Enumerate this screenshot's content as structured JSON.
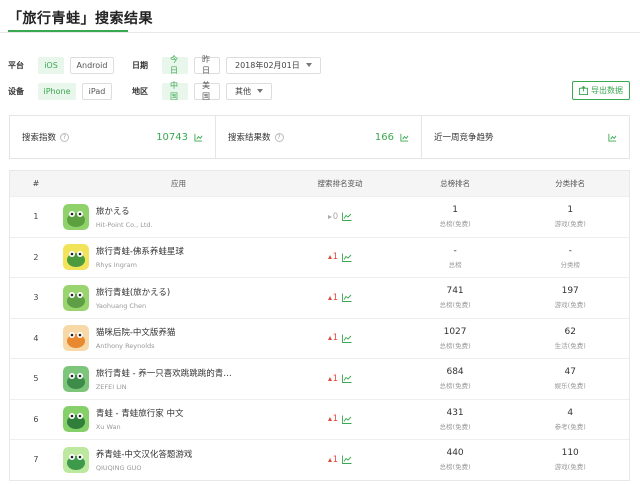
{
  "page": {
    "title": "「旅行青蛙」搜索结果"
  },
  "filters": {
    "platform_label": "平台",
    "platform_options": [
      "iOS",
      "Android"
    ],
    "date_label": "日期",
    "date_today": "今日",
    "date_yesterday": "昨日",
    "date_value": "2018年02月01日",
    "device_label": "设备",
    "device_options": [
      "iPhone",
      "iPad"
    ],
    "region_label": "地区",
    "region_options": [
      "中国",
      "美国"
    ],
    "region_other": "其他"
  },
  "export_label": "导出数据",
  "stats": {
    "search_index_label": "搜索指数",
    "search_index_value": "10743",
    "result_count_label": "搜索结果数",
    "result_count_value": "166",
    "trend_label": "近一周竞争趋势"
  },
  "table": {
    "headers": {
      "idx": "#",
      "app": "应用",
      "variation": "搜索排名变动",
      "total_rank": "总榜排名",
      "category_rank": "分类排名"
    },
    "rows": [
      {
        "idx": "1",
        "name": "旅かえる",
        "dev": "Hit-Point Co., Ltd.",
        "var": "0",
        "trend": "flat",
        "total": "1",
        "total_sub": "总榜(免费)",
        "cat": "1",
        "cat_sub": "游戏(免费)"
      },
      {
        "idx": "2",
        "name": "旅行青蛙-佛系养蛙星球",
        "dev": "Rhys Ingram",
        "var": "1",
        "trend": "up",
        "total": "-",
        "total_sub": "总榜",
        "cat": "-",
        "cat_sub": "分类榜"
      },
      {
        "idx": "3",
        "name": "旅行青蛙(旅かえる)",
        "dev": "Yaohuang Chen",
        "var": "1",
        "trend": "up",
        "total": "741",
        "total_sub": "总榜(免费)",
        "cat": "197",
        "cat_sub": "游戏(免费)"
      },
      {
        "idx": "4",
        "name": "猫咪后院-中文版养猫",
        "dev": "Anthony Reynolds",
        "var": "1",
        "trend": "up",
        "total": "1027",
        "total_sub": "总榜(免费)",
        "cat": "62",
        "cat_sub": "生活(免费)"
      },
      {
        "idx": "5",
        "name": "旅行青蛙 - 养一只喜欢跳跳跳的青…",
        "dev": "ZEFEI LIN",
        "var": "1",
        "trend": "up",
        "total": "684",
        "total_sub": "总榜(免费)",
        "cat": "47",
        "cat_sub": "娱乐(免费)"
      },
      {
        "idx": "6",
        "name": "青蛙 - 青蛙旅行家 中文",
        "dev": "Xu Wan",
        "var": "1",
        "trend": "up",
        "total": "431",
        "total_sub": "总榜(免费)",
        "cat": "4",
        "cat_sub": "参考(免费)"
      },
      {
        "idx": "7",
        "name": "养青蛙-中文汉化答题游戏",
        "dev": "QIUQING GUO",
        "var": "1",
        "trend": "up",
        "total": "440",
        "total_sub": "总榜(免费)",
        "cat": "110",
        "cat_sub": "游戏(免费)"
      }
    ]
  },
  "colors": {
    "accent": "#3aa850",
    "up": "#e04a3a",
    "flat": "#aaaaaa"
  }
}
